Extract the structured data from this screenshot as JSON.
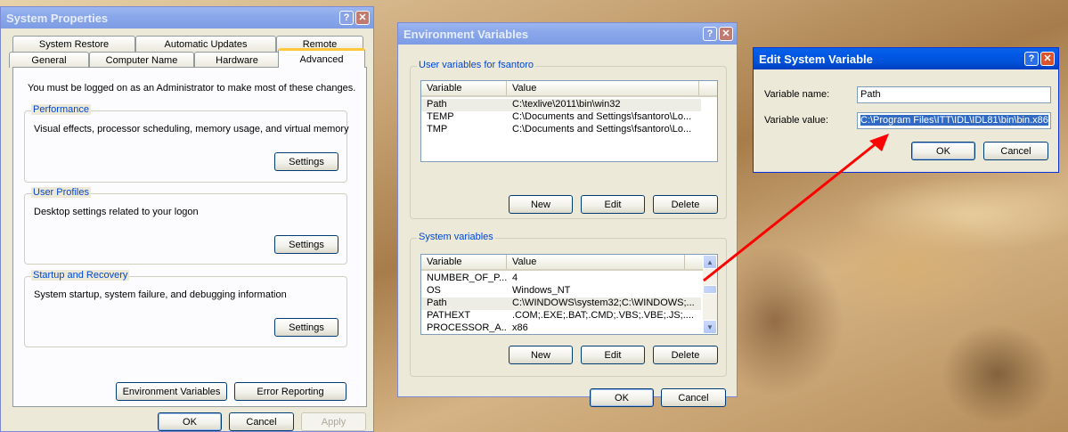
{
  "system_properties": {
    "title": "System Properties",
    "title_buttons": {
      "help": "?",
      "close": "✕"
    },
    "tabs_row1": [
      "System Restore",
      "Automatic Updates",
      "Remote"
    ],
    "tabs_row2": [
      "General",
      "Computer Name",
      "Hardware",
      "Advanced"
    ],
    "admin_note": "You must be logged on as an Administrator to make most of these changes.",
    "performance": {
      "title": "Performance",
      "desc": "Visual effects, processor scheduling, memory usage, and virtual memory",
      "button": "Settings"
    },
    "user_profiles": {
      "title": "User Profiles",
      "desc": "Desktop settings related to your logon",
      "button": "Settings"
    },
    "startup_recovery": {
      "title": "Startup and Recovery",
      "desc": "System startup, system failure, and debugging information",
      "button": "Settings"
    },
    "env_vars_button": "Environment Variables",
    "error_reporting_button": "Error Reporting",
    "ok": "OK",
    "cancel": "Cancel",
    "apply": "Apply"
  },
  "environment_variables": {
    "title": "Environment Variables",
    "title_buttons": {
      "help": "?",
      "close": "✕"
    },
    "user_group_title": "User variables for fsantoro",
    "columns": [
      "Variable",
      "Value"
    ],
    "user_vars": [
      {
        "variable": "Path",
        "value": "C:\\texlive\\2011\\bin\\win32"
      },
      {
        "variable": "TEMP",
        "value": "C:\\Documents and Settings\\fsantoro\\Lo..."
      },
      {
        "variable": "TMP",
        "value": "C:\\Documents and Settings\\fsantoro\\Lo..."
      }
    ],
    "system_group_title": "System variables",
    "system_vars": [
      {
        "variable": "NUMBER_OF_P...",
        "value": "4"
      },
      {
        "variable": "OS",
        "value": "Windows_NT"
      },
      {
        "variable": "Path",
        "value": "C:\\WINDOWS\\system32;C:\\WINDOWS;..."
      },
      {
        "variable": "PATHEXT",
        "value": ".COM;.EXE;.BAT;.CMD;.VBS;.VBE;.JS;...."
      },
      {
        "variable": "PROCESSOR_A...",
        "value": "x86"
      }
    ],
    "buttons": {
      "new": "New",
      "edit": "Edit",
      "delete": "Delete"
    },
    "ok": "OK",
    "cancel": "Cancel"
  },
  "edit_system_variable": {
    "title": "Edit System Variable",
    "title_buttons": {
      "help": "?",
      "close": "✕"
    },
    "name_label": "Variable name:",
    "name_value": "Path",
    "value_label": "Variable value:",
    "value_value": "C:\\Program Files\\ITT\\IDL\\IDL81\\bin\\bin.x86",
    "ok": "OK",
    "cancel": "Cancel"
  },
  "annotation": {
    "arrow_color": "#ff0000"
  },
  "colors": {
    "xp_titlebar_blue": "#0058e6",
    "xp_face": "#ece9d8",
    "group_title_blue": "#0046d5",
    "selection_blue": "#316ac5"
  }
}
